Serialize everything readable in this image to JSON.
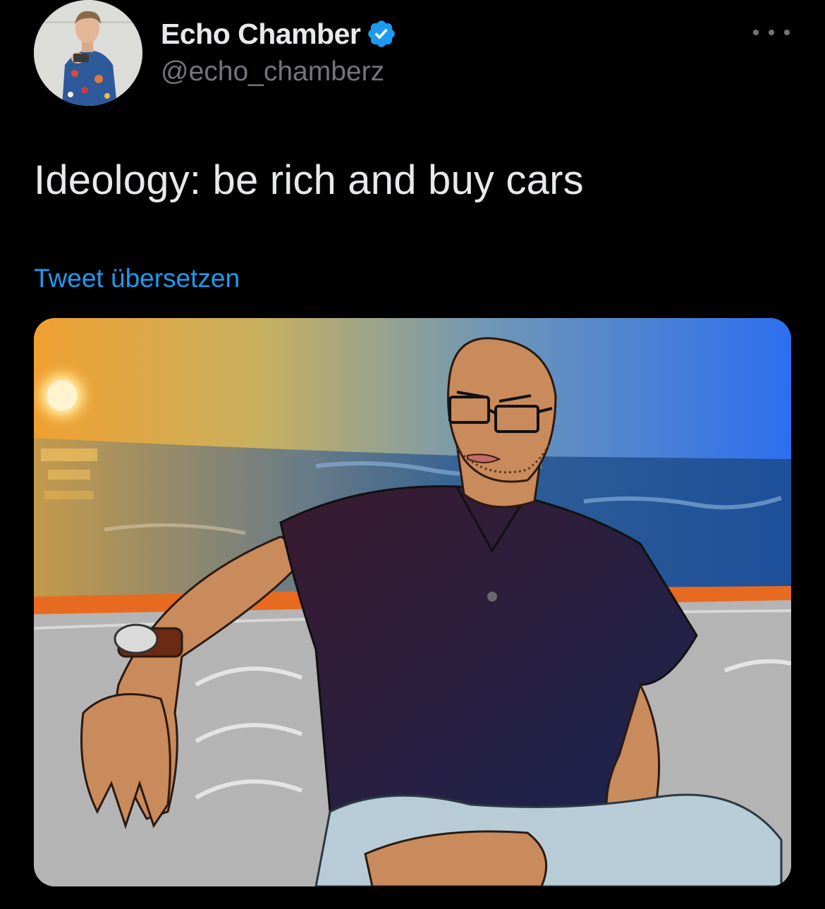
{
  "author": {
    "display_name": "Echo Chamber",
    "handle": "@echo_chamberz",
    "verified": true,
    "avatar_icon": "profile-photo-man-floral-shirt"
  },
  "tweet": {
    "text": "Ideology: be rich and buy cars",
    "translate_label": "Tweet übersetzen",
    "media_description": "drawn-meme-image-man-on-boat-at-sunset"
  },
  "actions": {
    "more_icon": "more-options-icon"
  },
  "colors": {
    "background": "#000000",
    "primary_text": "#e7e9ea",
    "secondary_text": "#71767b",
    "accent": "#1d9bf0"
  }
}
